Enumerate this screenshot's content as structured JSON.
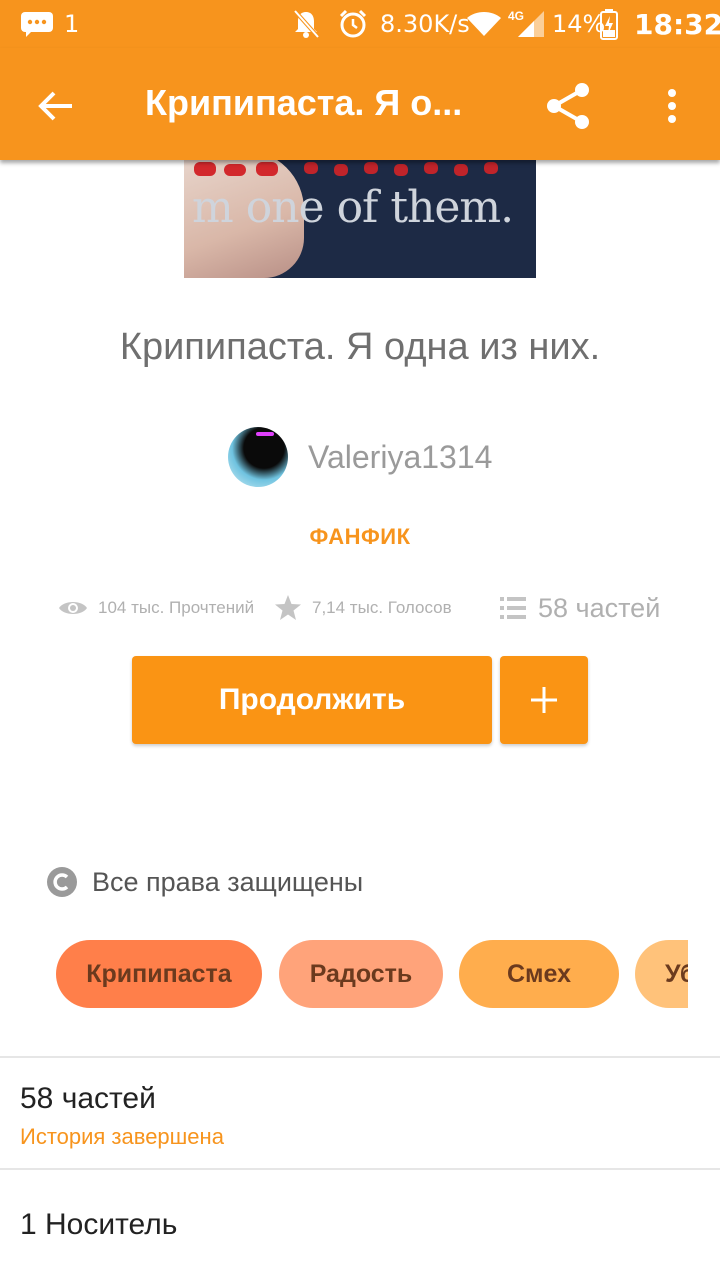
{
  "status_bar": {
    "notification_count": "1",
    "network_speed": "8.30K/s",
    "network_type": "4G",
    "battery": "14%",
    "time": "18:32",
    "icons": [
      "message-icon",
      "bell-off-icon",
      "alarm-icon",
      "wifi-icon",
      "signal-icon",
      "battery-charging-icon"
    ]
  },
  "app_bar": {
    "title": "Крипипаста. Я о...",
    "icons": [
      "back-arrow-icon",
      "share-icon",
      "more-vert-icon"
    ]
  },
  "cover": {
    "text": "m one of them."
  },
  "book": {
    "title": "Крипипаста. Я одна из них.",
    "author": "Valeriya1314",
    "category": "ФАНФИК"
  },
  "stats": {
    "reads": "104 тыс. Прочтений",
    "votes": "7,14 тыс. Голосов",
    "parts": "58 частей"
  },
  "actions": {
    "continue_label": "Продолжить",
    "add_label": "+"
  },
  "rights": {
    "label": "Все права защищены"
  },
  "tags": [
    {
      "label": "Крипипаста",
      "color": "#ff7f4a"
    },
    {
      "label": "Радость",
      "color": "#ffa37a"
    },
    {
      "label": "Смех",
      "color": "#ffad4d"
    },
    {
      "label": "Уб",
      "color": "#ffc27a"
    }
  ],
  "details": {
    "parts_count": "58 частей",
    "status": "История завершена",
    "carrier": "1 Носитель"
  },
  "colors": {
    "accent": "#f7941d",
    "button": "#fa9414"
  }
}
